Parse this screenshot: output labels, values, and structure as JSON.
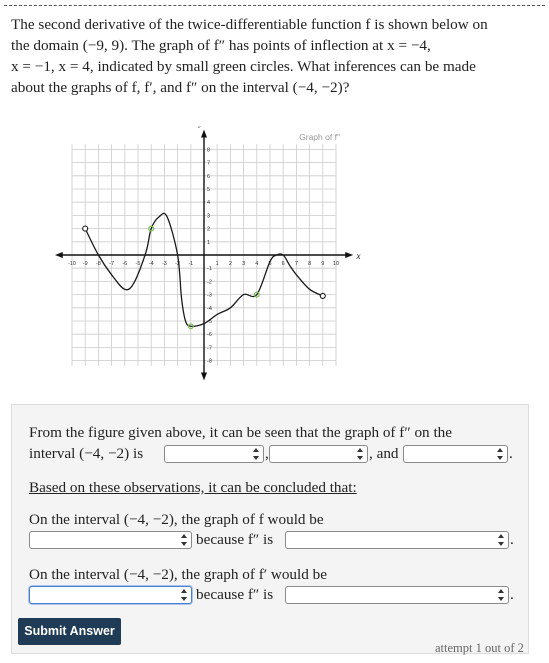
{
  "question": {
    "line1": "The second derivative of the twice-differentiable function f is shown below on",
    "line2": "the domain (−9, 9). The graph of f″ has points of inflection at x = −4,",
    "line3": "x = −1, x = 4, indicated by small green circles. What inferences can be made",
    "line4": "about the graphs of f, f′, and f″ on the interval (−4, −2)?"
  },
  "graph": {
    "title": "Graph of f″",
    "x_axis_label": "x",
    "y_axis_label": "y",
    "x_ticks": [
      "-10",
      "-9",
      "-8",
      "-7",
      "-6",
      "-5",
      "-4",
      "-3",
      "-2",
      "-1",
      "1",
      "2",
      "3",
      "4",
      "5",
      "6",
      "7",
      "8",
      "9",
      "10"
    ],
    "y_ticks": [
      "8",
      "7",
      "6",
      "5",
      "4",
      "3",
      "2",
      "1",
      "-1",
      "-2",
      "-3",
      "-4",
      "-5",
      "-6",
      "-7",
      "-8"
    ],
    "curve_points": [
      [
        -9,
        2
      ],
      [
        -8,
        0
      ],
      [
        -7,
        -1.5
      ],
      [
        -6,
        -2.6
      ],
      [
        -5.3,
        -2.1
      ],
      [
        -4.4,
        0.2
      ],
      [
        -4,
        2
      ],
      [
        -3.4,
        2.9
      ],
      [
        -2.8,
        2.9
      ],
      [
        -2,
        0
      ],
      [
        -1.7,
        -3.3
      ],
      [
        -1.4,
        -5
      ],
      [
        -1,
        -5.4
      ],
      [
        0,
        -5.2
      ],
      [
        1,
        -4.5
      ],
      [
        2,
        -4
      ],
      [
        3,
        -3
      ],
      [
        4,
        -3
      ],
      [
        5,
        -0.5
      ],
      [
        5.5,
        0
      ],
      [
        6,
        0
      ],
      [
        6.5,
        -0.8
      ],
      [
        7,
        -1.5
      ],
      [
        8,
        -2.6
      ],
      [
        9,
        -3.1
      ]
    ],
    "open_endpoints": [
      [
        -9,
        2
      ],
      [
        9,
        -3.1
      ]
    ],
    "inflection_points": [
      [
        -4,
        2
      ],
      [
        -1,
        -5.4
      ],
      [
        4,
        -3
      ]
    ],
    "colors": {
      "curve": "#1a1a1a",
      "inflection": "#7fbf5a",
      "grid": "#cccccc",
      "axis": "#111111"
    }
  },
  "panel": {
    "sentence1_a": "From the figure given above, it can be seen that the graph of f″ on the",
    "sentence1_b": "interval (−4, −2) is",
    "comma": ",",
    "and": ", and",
    "period": ".",
    "conclusion": "Based on these observations, it can be concluded that:",
    "f_line": "On the interval (−4, −2), the graph of f would be",
    "fp_line": "On the interval (−4, −2), the graph of f′ would be",
    "because": "because f″ is",
    "submit_label": "Submit Answer",
    "attempt": "attempt 1 out of 2"
  }
}
